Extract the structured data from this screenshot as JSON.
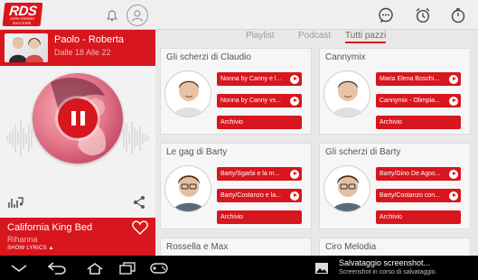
{
  "app": {
    "logo_text": "RDS",
    "logo_tagline": "100% GRANDI SUCCESSI"
  },
  "show": {
    "title": "Paolo - Roberta",
    "subtitle": "Dalle 18 Alle 22"
  },
  "now_playing": {
    "title": "California King Bed",
    "artist": "Rihanna",
    "lyrics_label": "SHOW LYRICS"
  },
  "tabs": [
    {
      "label": "Playlist",
      "active": false
    },
    {
      "label": "Podcast",
      "active": false
    },
    {
      "label": "Tutti pazzi",
      "active": true
    }
  ],
  "cards": [
    {
      "title": "Gli scherzi di Claudio",
      "items": [
        "Nonna by Canny e l...",
        "Nonna by Canny vs..."
      ],
      "archive_label": "Archivio"
    },
    {
      "title": "Cannymix",
      "items": [
        "Maria Elena Boschi...",
        "Cannymix - Olimpia..."
      ],
      "archive_label": "Archivio"
    },
    {
      "title": "Le gag di Barty",
      "items": [
        "Barty/Sgarbi e la m...",
        "Barty/Costanzo e la..."
      ],
      "archive_label": "Archivio"
    },
    {
      "title": "Gli scherzi di Barty",
      "items": [
        "Barty/Gino De Agos...",
        "Barty/Costanzo con..."
      ],
      "archive_label": "Archivio"
    },
    {
      "title": "Rossella e Max"
    },
    {
      "title": "Ciro Melodia"
    }
  ],
  "notification": {
    "title": "Salvataggio screenshot...",
    "subtitle": "Screenshot in corso di salvataggio."
  },
  "colors": {
    "accent": "#d7161d",
    "background": "#e9e9e9",
    "card": "#f6f6f6"
  },
  "icons": {
    "topbar": [
      "bell-icon",
      "user-icon",
      "chat-icon",
      "alarm-icon",
      "timer-icon"
    ],
    "navbar": [
      "back-icon",
      "home-icon",
      "recent-apps-icon",
      "gamepad-icon",
      "screenshot-icon"
    ]
  }
}
